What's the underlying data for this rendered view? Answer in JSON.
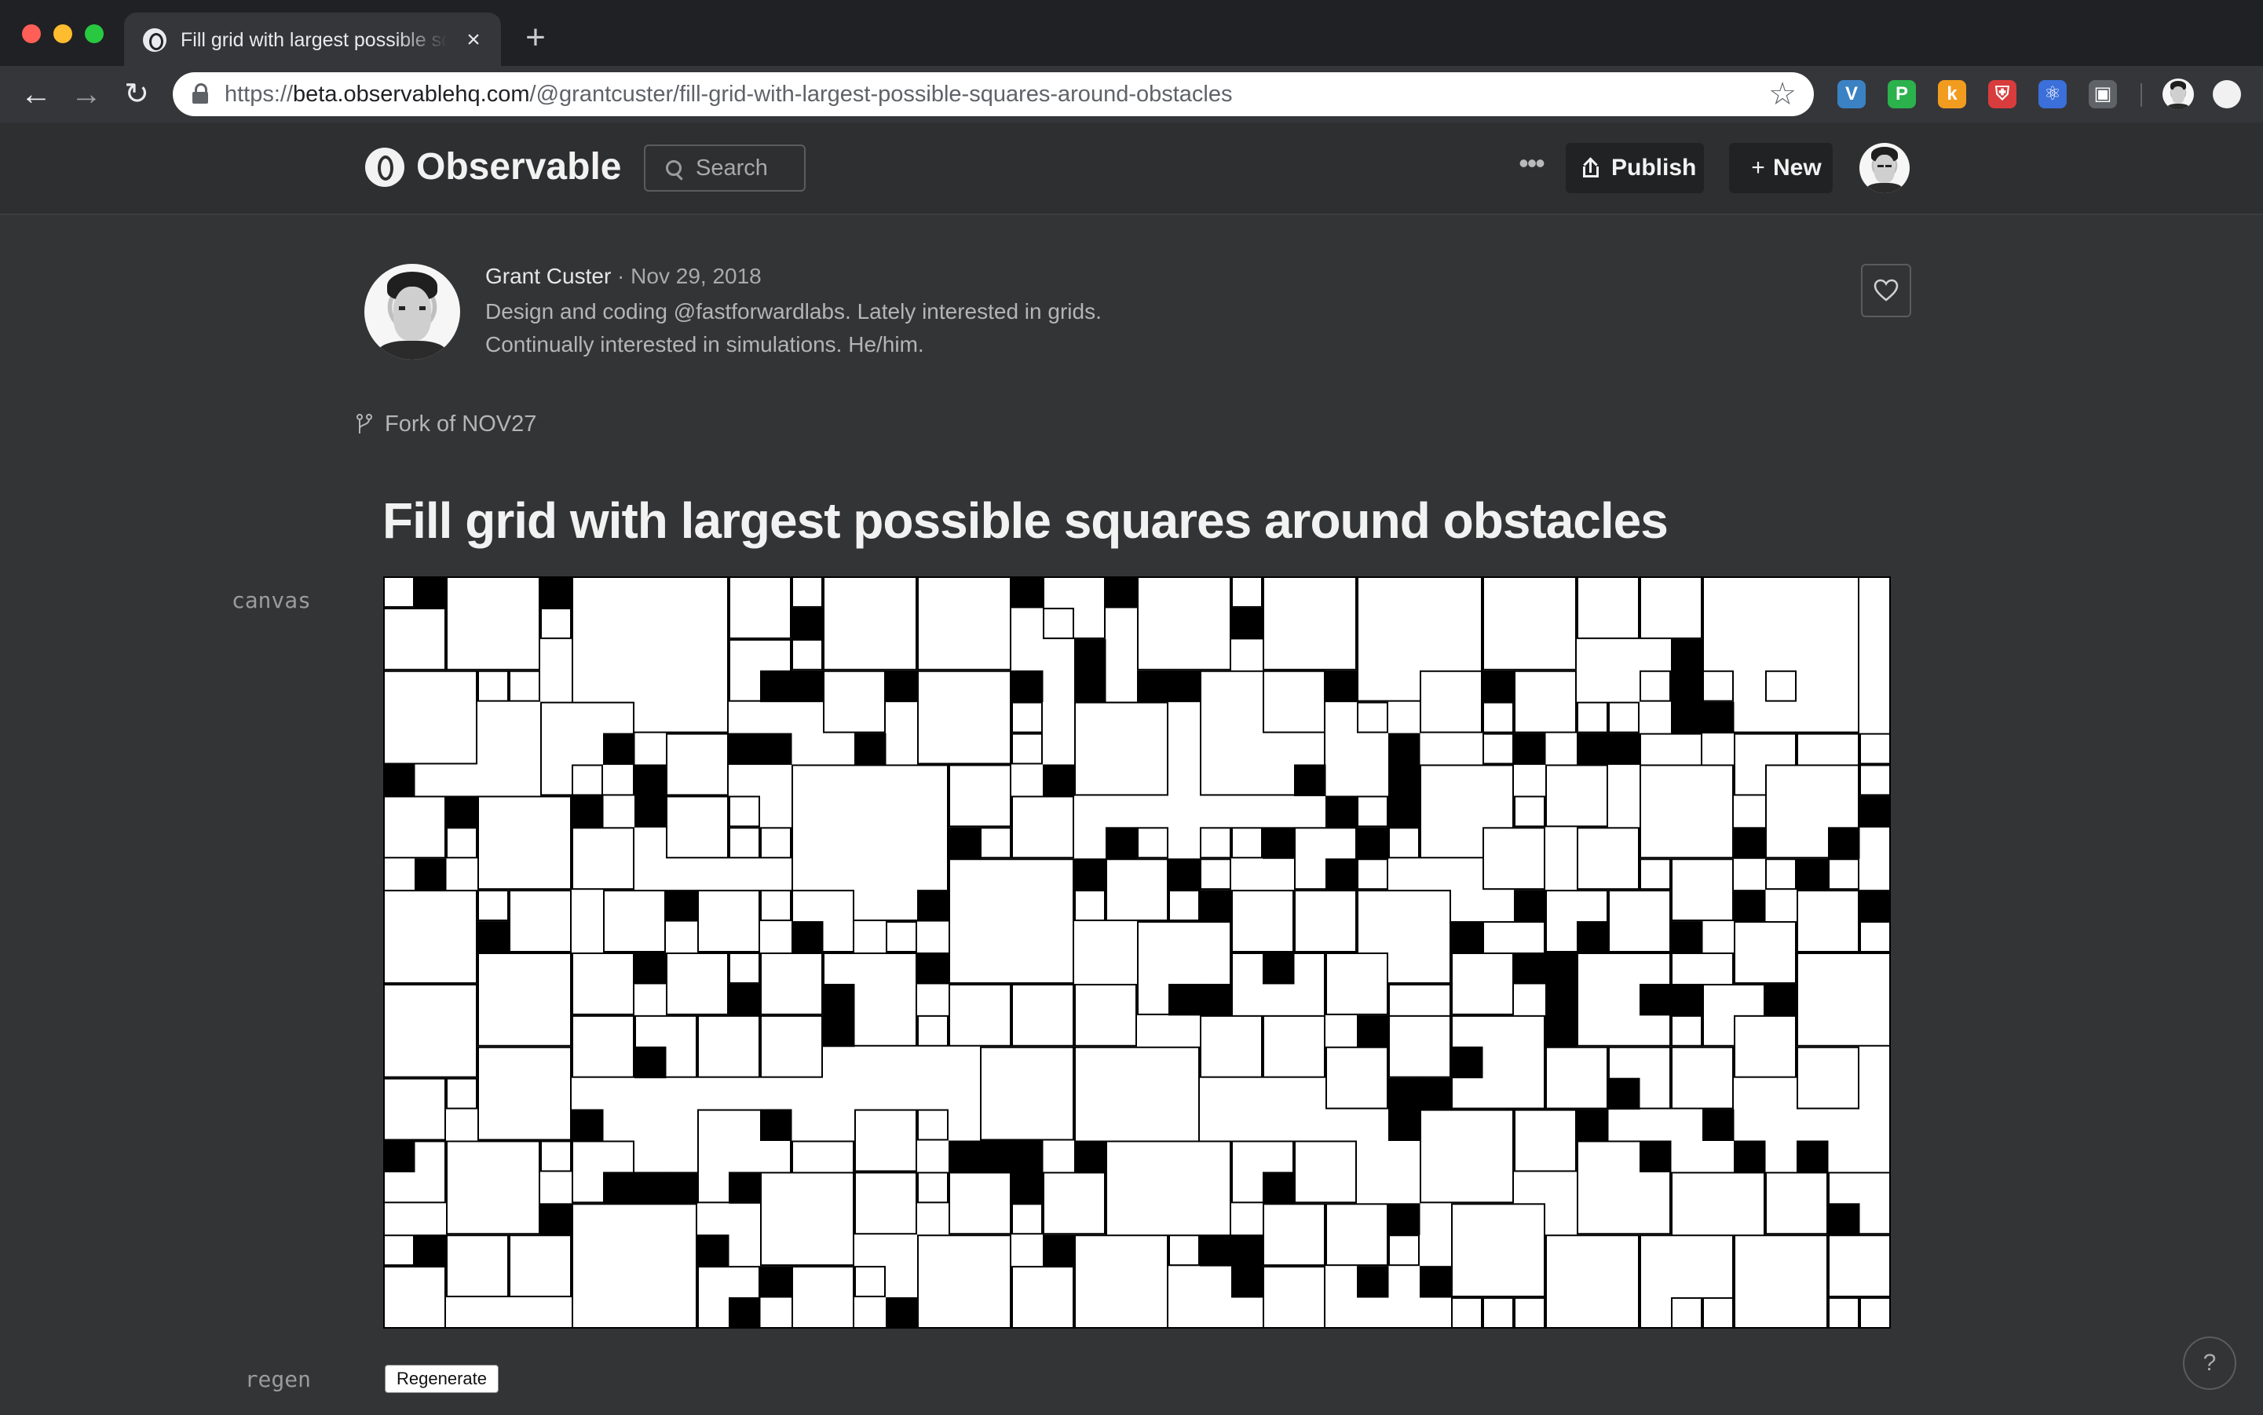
{
  "browser": {
    "tab_title": "Fill grid with largest possible squares around obstacles",
    "tab_close": "×",
    "new_tab": "+",
    "url_scheme": "https://",
    "url_host": "beta.observablehq.com",
    "url_path": "/@grantcuster/fill-grid-with-largest-possible-squares-around-obstacles",
    "extensions": [
      {
        "icon": "vimium-icon",
        "glyph": "V",
        "color": "#3b82c4"
      },
      {
        "icon": "pushbullet-icon",
        "glyph": "P",
        "color": "#2bb24c"
      },
      {
        "icon": "keep-icon",
        "glyph": "k",
        "color": "#f29c1f"
      },
      {
        "icon": "ublock-icon",
        "glyph": "⛨",
        "color": "#d93c3c"
      },
      {
        "icon": "react-devtools-icon",
        "glyph": "⚛",
        "color": "#3b6fd9"
      },
      {
        "icon": "picture-in-picture-icon",
        "glyph": "▣",
        "color": "#5f6368"
      }
    ]
  },
  "header": {
    "logo_text": "Observable",
    "search_placeholder": "Search",
    "more_label": "•••",
    "publish_label": "Publish",
    "new_icon": "+",
    "new_label": "New"
  },
  "author": {
    "name": "Grant Custer",
    "separator": " · ",
    "date": "Nov 29, 2018",
    "bio_line1": "Design and coding @fastforwardlabs. Lately interested in grids.",
    "bio_line2": "Continually interested in simulations. He/him."
  },
  "fork": {
    "label": "Fork of NOV27"
  },
  "notebook": {
    "title": "Fill grid with largest possible squares around obstacles",
    "canvas_label": "canvas",
    "regen_label": "regen",
    "regen_button": "Regenerate",
    "help": "?"
  },
  "grid": {
    "columns": 48,
    "rows": 24,
    "fill_color": "#ffffff",
    "obstacle_color": "#000000",
    "obstacle_cells": [
      [
        1,
        0
      ],
      [
        5,
        0
      ],
      [
        20,
        0
      ],
      [
        23,
        0
      ],
      [
        13,
        1
      ],
      [
        27,
        1
      ],
      [
        41,
        2
      ],
      [
        22,
        2
      ],
      [
        12,
        3
      ],
      [
        13,
        3
      ],
      [
        16,
        3
      ],
      [
        20,
        3
      ],
      [
        22,
        3
      ],
      [
        24,
        3
      ],
      [
        25,
        3
      ],
      [
        30,
        3
      ],
      [
        35,
        3
      ],
      [
        41,
        3
      ],
      [
        41,
        4
      ],
      [
        42,
        4
      ],
      [
        7,
        5
      ],
      [
        11,
        5
      ],
      [
        12,
        5
      ],
      [
        15,
        5
      ],
      [
        32,
        5
      ],
      [
        36,
        5
      ],
      [
        38,
        5
      ],
      [
        39,
        5
      ],
      [
        0,
        6
      ],
      [
        8,
        6
      ],
      [
        21,
        6
      ],
      [
        29,
        6
      ],
      [
        32,
        6
      ],
      [
        2,
        7
      ],
      [
        6,
        7
      ],
      [
        8,
        7
      ],
      [
        30,
        7
      ],
      [
        32,
        7
      ],
      [
        47,
        7
      ],
      [
        18,
        8
      ],
      [
        23,
        8
      ],
      [
        28,
        8
      ],
      [
        31,
        8
      ],
      [
        43,
        8
      ],
      [
        46,
        8
      ],
      [
        1,
        9
      ],
      [
        22,
        9
      ],
      [
        25,
        9
      ],
      [
        30,
        9
      ],
      [
        45,
        9
      ],
      [
        9,
        10
      ],
      [
        17,
        10
      ],
      [
        26,
        10
      ],
      [
        36,
        10
      ],
      [
        43,
        10
      ],
      [
        47,
        10
      ],
      [
        3,
        11
      ],
      [
        13,
        11
      ],
      [
        34,
        11
      ],
      [
        38,
        11
      ],
      [
        41,
        11
      ],
      [
        8,
        12
      ],
      [
        17,
        12
      ],
      [
        28,
        12
      ],
      [
        36,
        12
      ],
      [
        37,
        12
      ],
      [
        11,
        13
      ],
      [
        14,
        13
      ],
      [
        25,
        13
      ],
      [
        26,
        13
      ],
      [
        37,
        13
      ],
      [
        40,
        13
      ],
      [
        41,
        13
      ],
      [
        44,
        13
      ],
      [
        14,
        14
      ],
      [
        31,
        14
      ],
      [
        37,
        14
      ],
      [
        8,
        15
      ],
      [
        34,
        15
      ],
      [
        32,
        16
      ],
      [
        33,
        16
      ],
      [
        39,
        16
      ],
      [
        6,
        17
      ],
      [
        12,
        17
      ],
      [
        32,
        17
      ],
      [
        38,
        17
      ],
      [
        42,
        17
      ],
      [
        0,
        18
      ],
      [
        18,
        18
      ],
      [
        19,
        18
      ],
      [
        20,
        18
      ],
      [
        22,
        18
      ],
      [
        40,
        18
      ],
      [
        43,
        18
      ],
      [
        45,
        18
      ],
      [
        7,
        19
      ],
      [
        8,
        19
      ],
      [
        9,
        19
      ],
      [
        11,
        19
      ],
      [
        20,
        19
      ],
      [
        28,
        19
      ],
      [
        5,
        20
      ],
      [
        32,
        20
      ],
      [
        46,
        20
      ],
      [
        1,
        21
      ],
      [
        10,
        21
      ],
      [
        21,
        21
      ],
      [
        26,
        21
      ],
      [
        27,
        21
      ],
      [
        12,
        22
      ],
      [
        27,
        22
      ],
      [
        31,
        22
      ],
      [
        33,
        22
      ],
      [
        11,
        23
      ],
      [
        16,
        23
      ]
    ],
    "squares": [
      [
        0,
        0,
        1
      ],
      [
        2,
        0,
        3
      ],
      [
        6,
        0,
        5
      ],
      [
        11,
        0,
        2
      ],
      [
        13,
        0,
        1
      ],
      [
        14,
        0,
        3
      ],
      [
        17,
        0,
        3
      ],
      [
        21,
        0,
        2
      ],
      [
        24,
        0,
        3
      ],
      [
        27,
        0,
        1
      ],
      [
        28,
        0,
        3
      ],
      [
        31,
        0,
        4
      ],
      [
        35,
        0,
        3
      ],
      [
        38,
        0,
        2
      ],
      [
        40,
        0,
        2
      ],
      [
        42,
        0,
        5
      ],
      [
        0,
        1,
        2
      ],
      [
        5,
        1,
        1
      ],
      [
        11,
        2,
        2
      ],
      [
        21,
        1,
        1
      ],
      [
        13,
        2,
        1
      ],
      [
        14,
        3,
        2
      ],
      [
        17,
        3,
        3
      ],
      [
        20,
        4,
        1
      ],
      [
        23,
        4,
        1
      ],
      [
        26,
        3,
        4
      ],
      [
        33,
        3,
        2
      ],
      [
        40,
        3,
        1
      ],
      [
        42,
        3,
        1
      ],
      [
        44,
        3,
        1
      ],
      [
        0,
        3,
        3
      ],
      [
        3,
        3,
        1
      ],
      [
        4,
        3,
        1
      ],
      [
        5,
        4,
        3
      ],
      [
        28,
        3,
        2
      ],
      [
        31,
        4,
        1
      ],
      [
        36,
        3,
        2
      ],
      [
        38,
        4,
        1
      ],
      [
        39,
        4,
        1
      ],
      [
        35,
        4,
        1
      ],
      [
        35,
        5,
        1
      ],
      [
        37,
        6,
        2
      ],
      [
        40,
        5,
        2
      ],
      [
        43,
        5,
        2
      ],
      [
        45,
        5,
        2
      ],
      [
        6,
        6,
        1
      ],
      [
        9,
        5,
        2
      ],
      [
        13,
        6,
        5
      ],
      [
        18,
        6,
        2
      ],
      [
        20,
        5,
        1
      ],
      [
        22,
        4,
        3
      ],
      [
        33,
        6,
        3
      ],
      [
        44,
        6,
        3
      ],
      [
        47,
        5,
        1
      ],
      [
        47,
        6,
        1
      ],
      [
        0,
        7,
        2
      ],
      [
        3,
        7,
        3
      ],
      [
        9,
        7,
        2
      ],
      [
        11,
        7,
        1
      ],
      [
        19,
        8,
        1
      ],
      [
        20,
        7,
        2
      ],
      [
        24,
        8,
        1
      ],
      [
        26,
        8,
        1
      ],
      [
        29,
        8,
        2
      ],
      [
        31,
        7,
        1
      ],
      [
        36,
        7,
        1
      ],
      [
        38,
        8,
        2
      ],
      [
        40,
        6,
        3
      ],
      [
        44,
        9,
        1
      ],
      [
        2,
        8,
        1
      ],
      [
        6,
        8,
        2
      ],
      [
        11,
        8,
        1
      ],
      [
        12,
        8,
        1
      ],
      [
        18,
        9,
        4
      ],
      [
        22,
        10,
        1
      ],
      [
        23,
        9,
        2
      ],
      [
        25,
        10,
        1
      ],
      [
        26,
        9,
        1
      ],
      [
        27,
        8,
        1
      ],
      [
        31,
        9,
        1
      ],
      [
        32,
        8,
        1
      ],
      [
        35,
        8,
        2
      ],
      [
        40,
        9,
        1
      ],
      [
        41,
        9,
        2
      ],
      [
        46,
        9,
        1
      ],
      [
        0,
        10,
        3
      ],
      [
        3,
        10,
        1
      ],
      [
        4,
        10,
        2
      ],
      [
        7,
        10,
        2
      ],
      [
        10,
        10,
        2
      ],
      [
        12,
        10,
        1
      ],
      [
        13,
        10,
        2
      ],
      [
        16,
        11,
        1
      ],
      [
        24,
        11,
        3
      ],
      [
        27,
        10,
        2
      ],
      [
        29,
        10,
        2
      ],
      [
        31,
        10,
        3
      ],
      [
        35,
        11,
        2
      ],
      [
        37,
        10,
        2
      ],
      [
        39,
        10,
        2
      ],
      [
        41,
        12,
        2
      ],
      [
        43,
        11,
        2
      ],
      [
        45,
        10,
        2
      ],
      [
        47,
        11,
        1
      ],
      [
        0,
        13,
        3
      ],
      [
        3,
        12,
        3
      ],
      [
        6,
        12,
        2
      ],
      [
        9,
        12,
        2
      ],
      [
        11,
        12,
        1
      ],
      [
        12,
        12,
        2
      ],
      [
        14,
        12,
        3
      ],
      [
        18,
        13,
        2
      ],
      [
        20,
        13,
        2
      ],
      [
        22,
        13,
        2
      ],
      [
        27,
        12,
        3
      ],
      [
        30,
        12,
        2
      ],
      [
        32,
        13,
        2
      ],
      [
        34,
        12,
        2
      ],
      [
        38,
        12,
        3
      ],
      [
        41,
        14,
        1
      ],
      [
        42,
        13,
        2
      ],
      [
        45,
        12,
        3
      ],
      [
        0,
        16,
        2
      ],
      [
        2,
        16,
        1
      ],
      [
        3,
        15,
        3
      ],
      [
        6,
        14,
        2
      ],
      [
        8,
        14,
        2
      ],
      [
        10,
        14,
        2
      ],
      [
        12,
        14,
        2
      ],
      [
        17,
        14,
        1
      ],
      [
        19,
        15,
        3
      ],
      [
        22,
        15,
        4
      ],
      [
        26,
        14,
        2
      ],
      [
        28,
        14,
        2
      ],
      [
        30,
        15,
        2
      ],
      [
        32,
        14,
        2
      ],
      [
        34,
        14,
        3
      ],
      [
        37,
        15,
        2
      ],
      [
        39,
        15,
        2
      ],
      [
        41,
        15,
        2
      ],
      [
        43,
        14,
        2
      ],
      [
        45,
        15,
        2
      ],
      [
        0,
        18,
        2
      ],
      [
        2,
        18,
        3
      ],
      [
        5,
        18,
        1
      ],
      [
        6,
        18,
        2
      ],
      [
        10,
        17,
        3
      ],
      [
        13,
        18,
        2
      ],
      [
        15,
        17,
        2
      ],
      [
        17,
        17,
        1
      ],
      [
        18,
        19,
        2
      ],
      [
        21,
        19,
        2
      ],
      [
        23,
        18,
        4
      ],
      [
        27,
        18,
        2
      ],
      [
        29,
        18,
        2
      ],
      [
        33,
        17,
        3
      ],
      [
        36,
        17,
        2
      ],
      [
        38,
        18,
        3
      ],
      [
        41,
        19,
        3
      ],
      [
        44,
        19,
        2
      ],
      [
        46,
        19,
        2
      ],
      [
        0,
        21,
        1
      ],
      [
        2,
        21,
        2
      ],
      [
        4,
        21,
        2
      ],
      [
        6,
        20,
        4
      ],
      [
        10,
        22,
        2
      ],
      [
        12,
        19,
        3
      ],
      [
        15,
        19,
        2
      ],
      [
        17,
        19,
        1
      ],
      [
        17,
        21,
        3
      ],
      [
        20,
        20,
        1
      ],
      [
        22,
        21,
        3
      ],
      [
        25,
        21,
        1
      ],
      [
        28,
        20,
        2
      ],
      [
        30,
        20,
        2
      ],
      [
        32,
        21,
        1
      ],
      [
        34,
        20,
        3
      ],
      [
        37,
        21,
        3
      ],
      [
        40,
        21,
        3
      ],
      [
        43,
        21,
        3
      ],
      [
        46,
        21,
        2
      ],
      [
        0,
        22,
        2
      ],
      [
        13,
        22,
        2
      ],
      [
        15,
        22,
        1
      ],
      [
        20,
        22,
        2
      ],
      [
        28,
        22,
        2
      ],
      [
        34,
        23,
        1
      ],
      [
        35,
        23,
        1
      ],
      [
        36,
        23,
        1
      ],
      [
        41,
        23,
        1
      ],
      [
        42,
        23,
        1
      ],
      [
        46,
        23,
        1
      ],
      [
        47,
        23,
        1
      ]
    ]
  }
}
